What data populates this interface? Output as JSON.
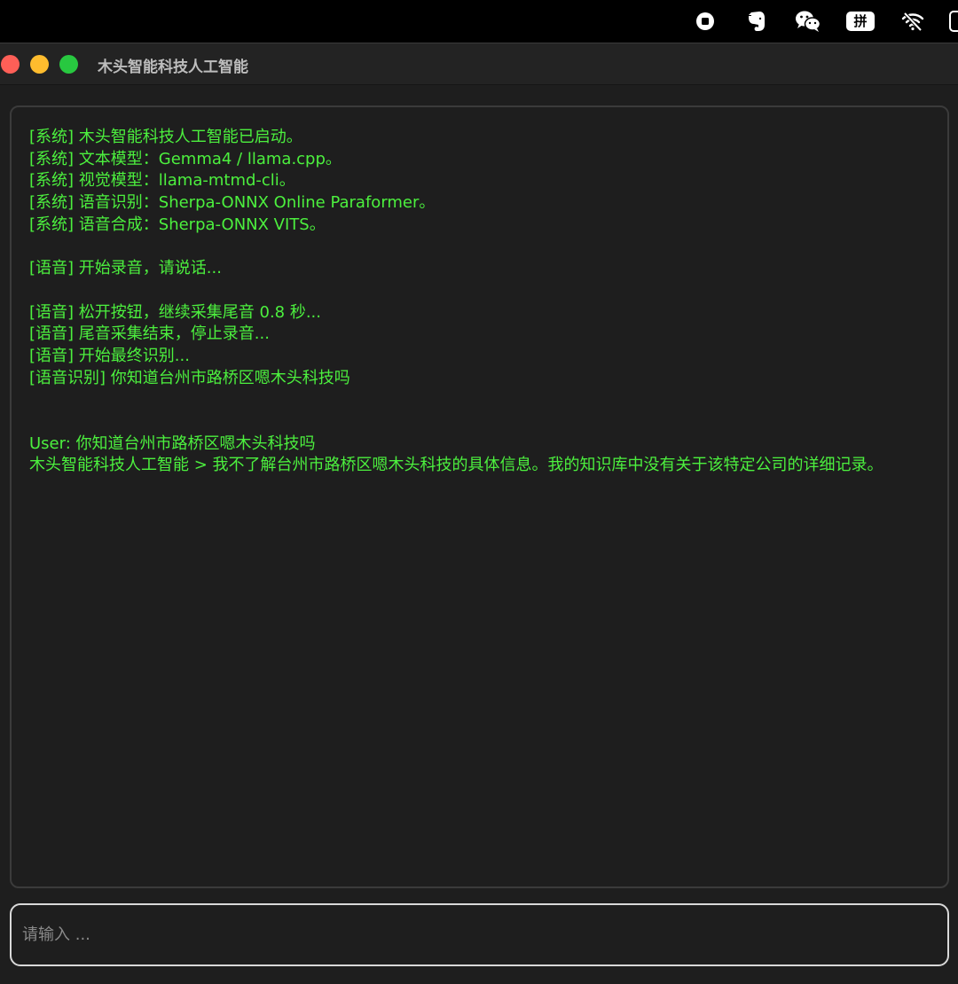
{
  "menubar": {
    "icons": [
      "stop-record-icon",
      "evernote-icon",
      "wechat-icon",
      "input-method-icon",
      "wifi-off-icon",
      "battery-icon"
    ],
    "input_method_label": "拼"
  },
  "window": {
    "title": "木头智能科技人工智能"
  },
  "output": {
    "lines": [
      "[系统] 木头智能科技人工智能已启动。",
      "[系统] 文本模型：Gemma4 / llama.cpp。",
      "[系统] 视觉模型：llama-mtmd-cli。",
      "[系统] 语音识别：Sherpa-ONNX Online Paraformer。",
      "[系统] 语音合成：Sherpa-ONNX VITS。",
      "",
      "[语音] 开始录音，请说话...",
      "",
      "[语音] 松开按钮，继续采集尾音 0.8 秒...",
      "[语音] 尾音采集结束，停止录音...",
      "[语音] 开始最终识别...",
      "[语音识别] 你知道台州市路桥区嗯木头科技吗",
      "",
      "",
      "User: 你知道台州市路桥区嗯木头科技吗",
      "木头智能科技人工智能 > 我不了解台州市路桥区嗯木头科技的具体信息。我的知识库中没有关于该特定公司的详细记录。"
    ]
  },
  "input": {
    "placeholder": "请输入 ...",
    "value": ""
  },
  "colors": {
    "terminal_text": "#4cf03e",
    "background": "#1e1e1e",
    "close": "#fe5f57",
    "minimize": "#febc2e",
    "maximize": "#28c840"
  }
}
